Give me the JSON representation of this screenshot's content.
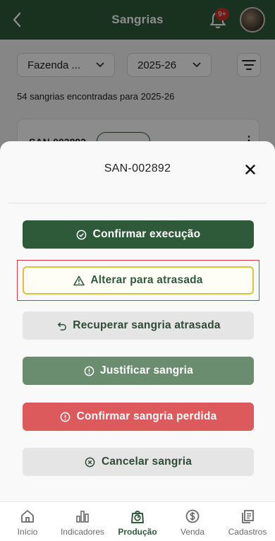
{
  "header": {
    "title": "Sangrias",
    "notification_badge": "9+"
  },
  "filters": {
    "farm": "Fazenda ...",
    "season": "2025-26"
  },
  "results": {
    "count_text": "54 sangrias encontradas para 2025-26"
  },
  "card_peek": {
    "code": "SAN-002892"
  },
  "sheet": {
    "title": "SAN-002892",
    "actions": {
      "confirm": "Confirmar execução",
      "mark_late": "Alterar para atrasada",
      "recover": "Recuperar sangria atrasada",
      "justify": "Justificar sangria",
      "confirm_lost": "Confirmar sangria perdida",
      "cancel": "Cancelar sangria"
    }
  },
  "nav": {
    "items": [
      {
        "label": "Início",
        "icon": "home-icon"
      },
      {
        "label": "Indicadores",
        "icon": "bar-chart-icon"
      },
      {
        "label": "Produção",
        "icon": "scale-icon"
      },
      {
        "label": "Venda",
        "icon": "dollar-icon"
      },
      {
        "label": "Cadastros",
        "icon": "documents-icon"
      }
    ],
    "active_index": 2
  },
  "colors": {
    "primary": "#2e5a3a",
    "warning_border": "#e2bf3a",
    "danger": "#dc5a5c",
    "justify": "#6b8d6f",
    "badge": "#c8332b"
  }
}
